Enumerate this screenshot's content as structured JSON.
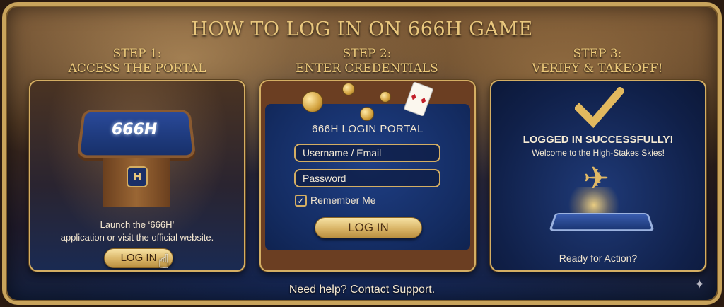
{
  "title": "HOW TO LOG IN ON 666H GAME",
  "steps": [
    {
      "heading_line1": "STEP 1:",
      "heading_line2": "ACCESS THE PORTAL",
      "logo_text": "666H",
      "badge_text": "H",
      "desc_line1": "Launch the ‘666H’",
      "desc_line2": "application or visit the official website.",
      "button_label": "LOG IN"
    },
    {
      "heading_line1": "STEP 2:",
      "heading_line2": "ENTER CREDENTIALS",
      "portal_title": "666H LOGIN PORTAL",
      "username_placeholder": "Username / Email",
      "password_placeholder": "Password",
      "remember_label": "Remember Me",
      "remember_checked": true,
      "button_label": "LOG IN"
    },
    {
      "heading_line1": "STEP 3:",
      "heading_line2": "VERIFY & TAKEOFF!",
      "success_title": "LOGGED IN SUCCESSFULLY!",
      "success_sub": "Welcome to the High-Stakes Skies!",
      "footer": "Ready for Action?"
    }
  ],
  "help_text": "Need help? Contact Support.",
  "colors": {
    "gold": "#d4ae63",
    "title_gold": "#e9c77d",
    "navy": "#142c62"
  },
  "icons": [
    "hand-pointer-icon",
    "checkmark-icon",
    "plane-icon",
    "playing-card-icon",
    "sparkle-icon"
  ]
}
